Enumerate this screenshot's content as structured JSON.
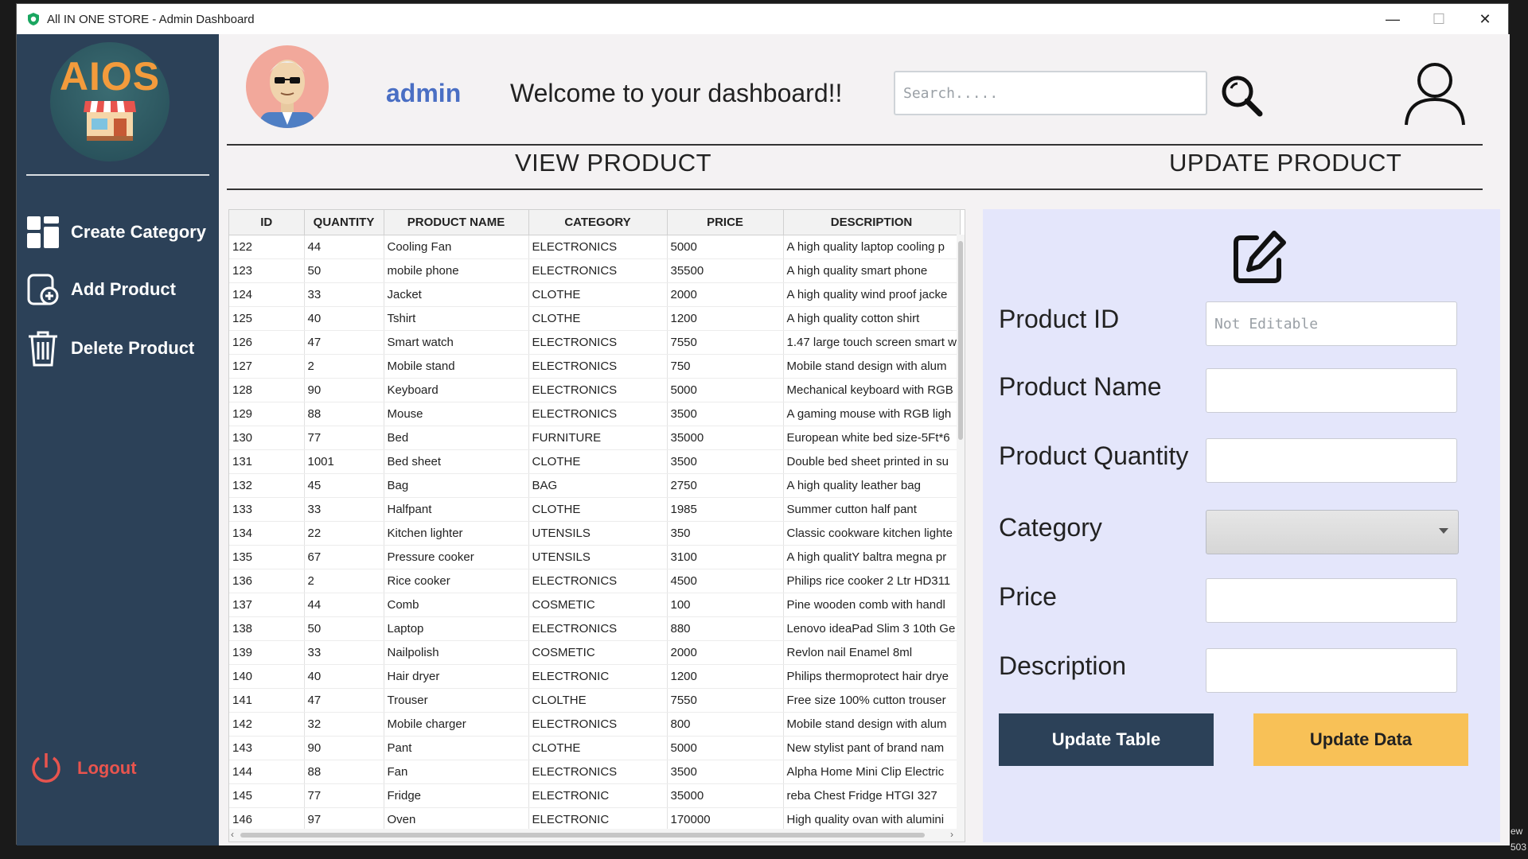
{
  "window": {
    "title": "All IN ONE STORE - Admin Dashboard",
    "minimize": "—",
    "maximize": "☐",
    "close": "✕"
  },
  "sidebar": {
    "logo_text": "AIOS",
    "items": [
      {
        "label": "Create Category",
        "icon": "grid-icon"
      },
      {
        "label": "Add Product",
        "icon": "add-product-icon"
      },
      {
        "label": "Delete Product",
        "icon": "trash-icon"
      }
    ],
    "logout": "Logout"
  },
  "header": {
    "username": "admin",
    "welcome": "Welcome to your dashboard!!",
    "search_placeholder": "Search.....",
    "view_title": "VIEW PRODUCT",
    "update_title": "UPDATE PRODUCT"
  },
  "table": {
    "columns": [
      "ID",
      "QUANTITY",
      "PRODUCT NAME",
      "CATEGORY",
      "PRICE",
      "DESCRIPTION"
    ],
    "rows": [
      [
        "122",
        "44",
        "Cooling Fan",
        "ELECTRONICS",
        "5000",
        "A high quality laptop cooling p"
      ],
      [
        "123",
        "50",
        "mobile phone",
        "ELECTRONICS",
        "35500",
        "A high quality smart phone"
      ],
      [
        "124",
        "33",
        "Jacket",
        "CLOTHE",
        "2000",
        "A high quality wind proof jacke"
      ],
      [
        "125",
        "40",
        "Tshirt",
        "CLOTHE",
        "1200",
        "A high quality cotton shirt"
      ],
      [
        "126",
        "47",
        "Smart watch",
        "ELECTRONICS",
        "7550",
        "1.47 large touch screen smart w"
      ],
      [
        "127",
        "2",
        "Mobile stand",
        "ELECTRONICS",
        "750",
        "Mobile stand design with alum"
      ],
      [
        "128",
        "90",
        "Keyboard",
        "ELECTRONICS",
        "5000",
        "Mechanical keyboard with RGB"
      ],
      [
        "129",
        "88",
        "Mouse",
        "ELECTRONICS",
        "3500",
        "A gaming mouse with RGB ligh"
      ],
      [
        "130",
        "77",
        "Bed",
        "FURNITURE",
        "35000",
        "European white bed size-5Ft*6"
      ],
      [
        "131",
        "1001",
        "Bed sheet",
        "CLOTHE",
        "3500",
        "Double bed sheet printed in su"
      ],
      [
        "132",
        "45",
        "Bag",
        "BAG",
        "2750",
        "A high quality leather bag"
      ],
      [
        "133",
        "33",
        "Halfpant",
        "CLOTHE",
        "1985",
        "Summer cutton half pant"
      ],
      [
        "134",
        "22",
        "Kitchen lighter",
        "UTENSILS",
        "350",
        "Classic cookware kitchen lighte"
      ],
      [
        "135",
        "67",
        "Pressure cooker",
        "UTENSILS",
        "3100",
        "A high qualitY baltra megna pr"
      ],
      [
        "136",
        "2",
        "Rice cooker",
        "ELECTRONICS",
        "4500",
        "Philips rice cooker 2 Ltr HD311"
      ],
      [
        "137",
        "44",
        "Comb",
        "COSMETIC",
        "100",
        "Pine wooden comb with handl"
      ],
      [
        "138",
        "50",
        "Laptop",
        "ELECTRONICS",
        "880",
        "Lenovo ideaPad Slim 3 10th Ge"
      ],
      [
        "139",
        "33",
        "Nailpolish",
        "COSMETIC",
        "2000",
        "Revlon nail Enamel 8ml"
      ],
      [
        "140",
        "40",
        "Hair dryer",
        "ELECTRONIC",
        "1200",
        "Philips thermoprotect hair drye"
      ],
      [
        "141",
        "47",
        "Trouser",
        "CLOLTHE",
        "7550",
        "Free size 100% cutton trouser"
      ],
      [
        "142",
        "32",
        "Mobile charger",
        "ELECTRONICS",
        "800",
        "Mobile stand design with alum"
      ],
      [
        "143",
        "90",
        "Pant",
        "CLOTHE",
        "5000",
        "New stylist pant of brand nam"
      ],
      [
        "144",
        "88",
        "Fan",
        "ELECTRONICS",
        "3500",
        "Alpha Home Mini Clip Electric"
      ],
      [
        "145",
        "77",
        "Fridge",
        "ELECTRONIC",
        "35000",
        "reba Chest Fridge HTGI 327"
      ],
      [
        "146",
        "97",
        "Oven",
        "ELECTRONIC",
        "170000",
        "High quality ovan with alumini"
      ]
    ]
  },
  "form": {
    "product_id_label": "Product ID",
    "product_id_placeholder": "Not Editable",
    "product_name_label": "Product Name",
    "product_quantity_label": "Product Quantity",
    "category_label": "Category",
    "price_label": "Price",
    "description_label": "Description",
    "update_table": "Update Table",
    "update_data": "Update Data"
  },
  "colors": {
    "sidebar": "#2c4158",
    "panel": "#e4e6fb",
    "accent_gold": "#f8c157",
    "logout": "#e8544e",
    "username": "#4a6fc4"
  },
  "corner_text": [
    "ew",
    "503"
  ]
}
